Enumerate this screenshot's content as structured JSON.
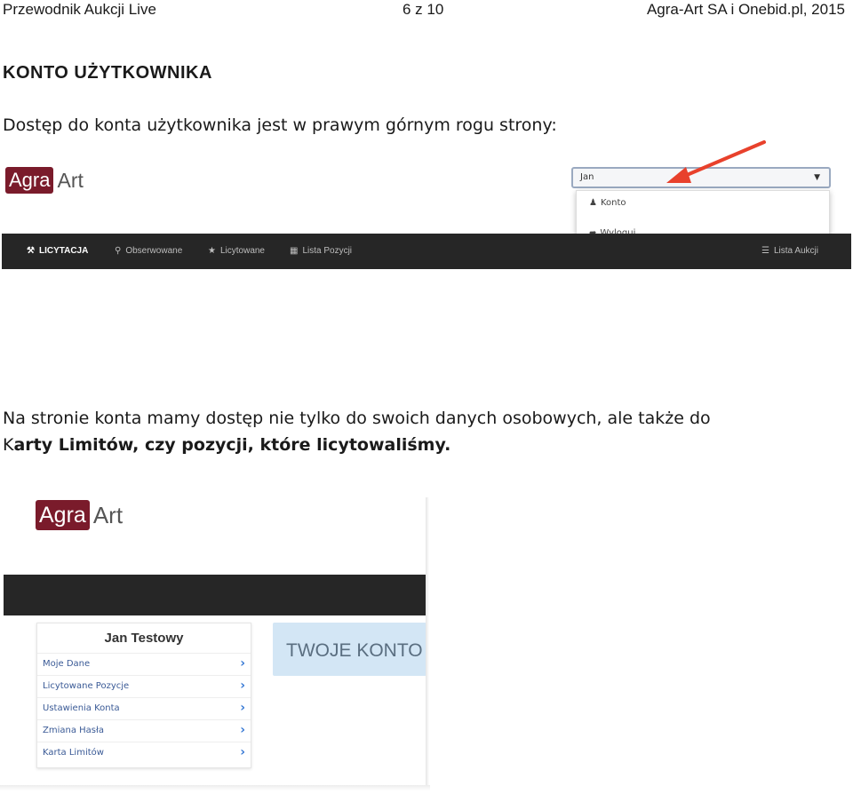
{
  "header": {
    "left": "Przewodnik Aukcji Live",
    "center": "6 z 10",
    "right": "Agra-Art SA i Onebid.pl, 2015"
  },
  "section_title": "KONTO UŻYTKOWNIKA",
  "intro_text": "Dostęp do konta użytkownika jest w prawym górnym rogu strony:",
  "screenshot1": {
    "logo_agra": "Agra",
    "logo_art": "Art",
    "user_select_value": "Jan",
    "dropdown_items": [
      "Konto",
      "Wyloguj"
    ],
    "nav_items": [
      "LICYTACJA",
      "Obserwowane",
      "Licytowane",
      "Lista Pozycji",
      "Lista Aukcji"
    ],
    "arrow_color": "#e8412c"
  },
  "body_text_plain": "Na stronie konta mamy dostęp nie tylko do swoich danych osobowych, ale także do",
  "body_text_k": "K",
  "body_text_bold": "arty Limitów, czy pozycji, które licytowaliśmy.",
  "screenshot2": {
    "logo_agra": "Agra",
    "logo_art": "Art",
    "panel_title": "Jan Testowy",
    "panel_items": [
      "Moje Dane",
      "Licytowane Pozycje",
      "Ustawienia Konta",
      "Zmiana Hasła",
      "Karta Limitów"
    ],
    "account_banner": "TWOJE KONTO"
  }
}
